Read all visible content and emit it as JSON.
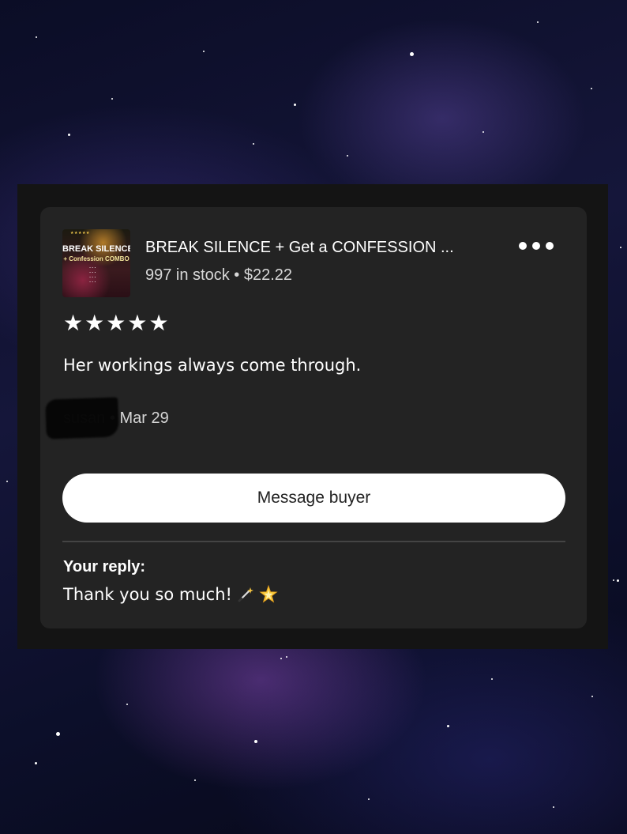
{
  "product": {
    "thumbnail_title": "BREAK SILENCE",
    "thumbnail_subtitle": "+ Confession COMBO",
    "title": "BREAK SILENCE + Get a CONFESSION ...",
    "meta": "997 in stock • $22.22"
  },
  "review": {
    "stars": 5,
    "star_glyphs": [
      "★",
      "★",
      "★",
      "★",
      "★"
    ],
    "text": "Her workings always come through.",
    "reviewer_name": "susan",
    "date_sep": " • ",
    "date": "Mar 29"
  },
  "actions": {
    "message_buyer_label": "Message buyer",
    "more_icon": "more-horizontal-icon"
  },
  "reply": {
    "label": "Your reply:",
    "text": "Thank you so much!",
    "icons": [
      "magic-wand-icon",
      "glowing-star-icon"
    ]
  },
  "colors": {
    "card": "#232323",
    "panel": "#141414",
    "button": "#ffffff",
    "text": "#ffffff"
  }
}
